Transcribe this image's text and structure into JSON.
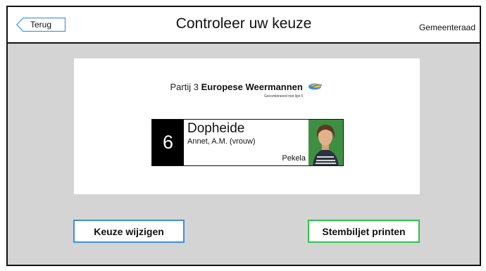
{
  "header": {
    "back_label": "Terug",
    "title": "Controleer uw keuze",
    "race": "Gemeenteraad"
  },
  "party": {
    "number_label": "Partij 3",
    "name": "Europese Weermannen",
    "combined_note": "Gecombineerd met lijst 5"
  },
  "candidate": {
    "number": "6",
    "last_name": "Dopheide",
    "first_name": "Annet, A.M.  (vrouw)",
    "city": "Pekela"
  },
  "buttons": {
    "change_label": "Keuze wijzigen",
    "print_label": "Stembiljet printen"
  },
  "colors": {
    "back_border": "#3a8ee6",
    "change_border": "#3a8ee6",
    "print_border": "#2ec24b",
    "photo_background": "#3f8f43"
  }
}
